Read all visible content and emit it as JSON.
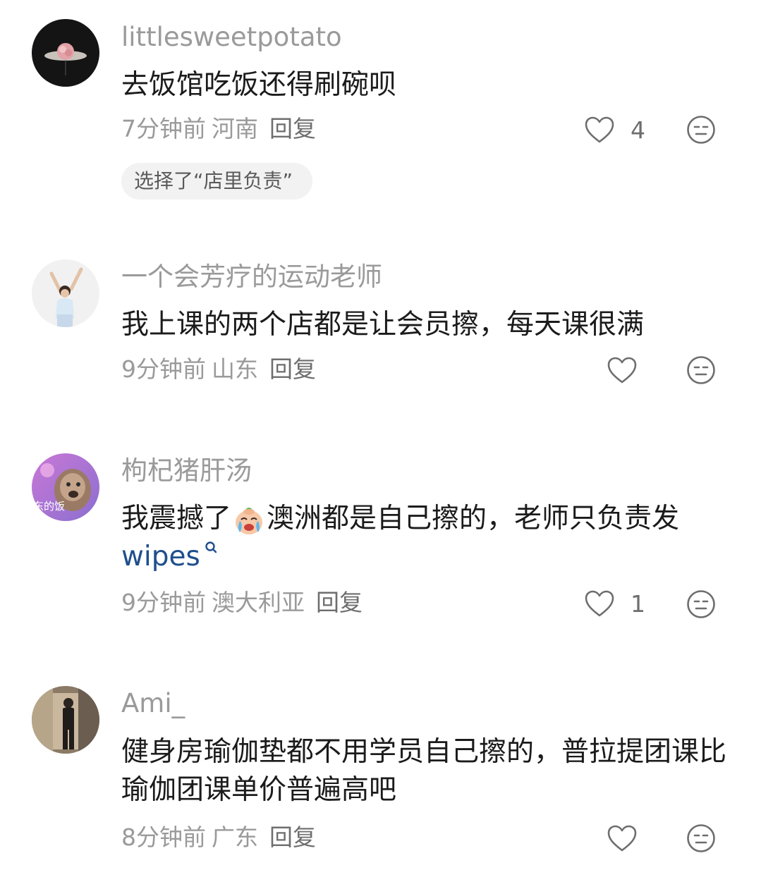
{
  "comments": [
    {
      "username": "littlesweetpotato",
      "text": "去饭馆吃饭还得刷碗呗",
      "time": "7分钟前",
      "location": "河南",
      "reply_label": "回复",
      "likes": "4",
      "choice_chip": "选择了“店里负责”"
    },
    {
      "username": "一个会芳疗的运动老师",
      "text": "我上课的两个店都是让会员擦，每天课很满",
      "time": "9分钟前",
      "location": "山东",
      "reply_label": "回复"
    },
    {
      "username": "枸杞猪肝汤",
      "text_part1": "我震撼了",
      "text_part2": "澳洲都是自己擦的，老师只负责发",
      "link_text": "wipes",
      "avatar_caption": "东的饭",
      "time": "9分钟前",
      "location": "澳大利亚",
      "reply_label": "回复",
      "likes": "1"
    },
    {
      "username": "Ami_",
      "text": "健身房瑜伽垫都不用学员自己擦的，普拉提团课比瑜伽团课单价普遍高吧",
      "time": "8分钟前",
      "location": "广东",
      "reply_label": "回复"
    }
  ],
  "icons": {
    "like": "heart-outline-icon",
    "dislike": "meh-face-icon",
    "search": "search-icon",
    "emoji": "crying-face-emoji"
  },
  "colors": {
    "username": "#9a9a9a",
    "text": "#1b1b1b",
    "meta": "#9a9a9a",
    "link": "#1e4f8c",
    "chip_bg": "#f2f2f2"
  }
}
